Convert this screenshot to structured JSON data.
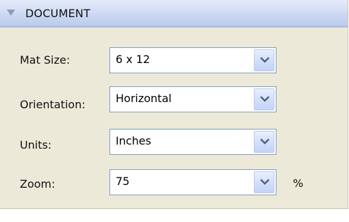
{
  "section": {
    "title": "DOCUMENT",
    "icon": "triangle-down-icon"
  },
  "fields": {
    "mat_size": {
      "label": "Mat Size:",
      "value": "6 x 12"
    },
    "orientation": {
      "label": "Orientation:",
      "value": "Horizontal"
    },
    "units": {
      "label": "Units:",
      "value": "Inches"
    },
    "zoom": {
      "label": "Zoom:",
      "value": "75",
      "unit": "%"
    }
  },
  "colors": {
    "header_background": "#cdd9f3",
    "panel_background": "#ece9d8",
    "dropdown_border": "#7f9db9",
    "dropdown_arrow": "#4d6185"
  }
}
